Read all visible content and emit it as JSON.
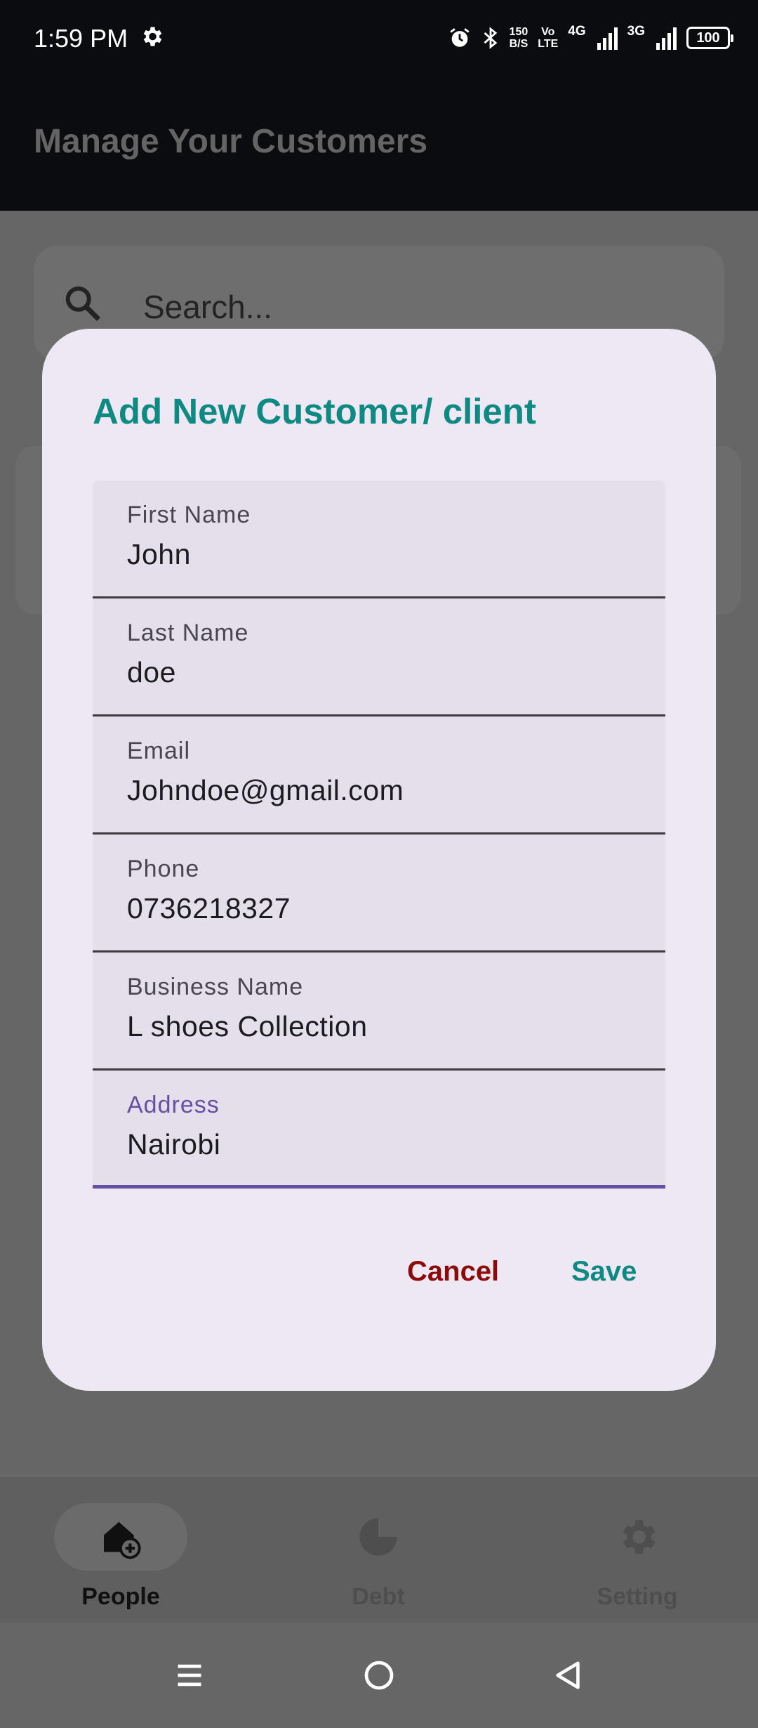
{
  "status_bar": {
    "time": "1:59 PM",
    "net_speed_value": "150",
    "net_speed_unit": "B/S",
    "volte_top": "Vo",
    "volte_bottom": "LTE",
    "sim1_network": "4G",
    "sim2_network": "3G",
    "battery": "100",
    "icons": [
      "gear-icon",
      "alarm-icon",
      "bluetooth-icon",
      "signal-icon",
      "battery-icon"
    ]
  },
  "app_bar": {
    "title": "Manage Your Customers"
  },
  "search": {
    "placeholder": "Search..."
  },
  "dialog": {
    "title": "Add New Customer/ client",
    "fields": [
      {
        "label": "First Name",
        "value": "John"
      },
      {
        "label": "Last Name",
        "value": "doe"
      },
      {
        "label": "Email",
        "value": "Johndoe@gmail.com"
      },
      {
        "label": "Phone",
        "value": "0736218327"
      },
      {
        "label": "Business Name",
        "value": "L shoes Collection"
      },
      {
        "label": "Address",
        "value": "Nairobi",
        "focused": true
      }
    ],
    "cancel_label": "Cancel",
    "save_label": "Save"
  },
  "bottom_nav": {
    "items": [
      {
        "label": "People",
        "icon": "people-add-icon",
        "active": true
      },
      {
        "label": "Debt",
        "icon": "pie-chart-icon",
        "active": false
      },
      {
        "label": "Setting",
        "icon": "gear-icon",
        "active": false
      }
    ]
  },
  "system_nav": {
    "icons": [
      "menu-icon",
      "home-icon",
      "back-icon"
    ]
  },
  "colors": {
    "accent": "#0e8a82",
    "cancel": "#8b0a0a",
    "focus": "#6750a4",
    "dialog_bg": "#eee8f4",
    "field_bg": "#e5dfeb",
    "scrim": "#666666"
  }
}
